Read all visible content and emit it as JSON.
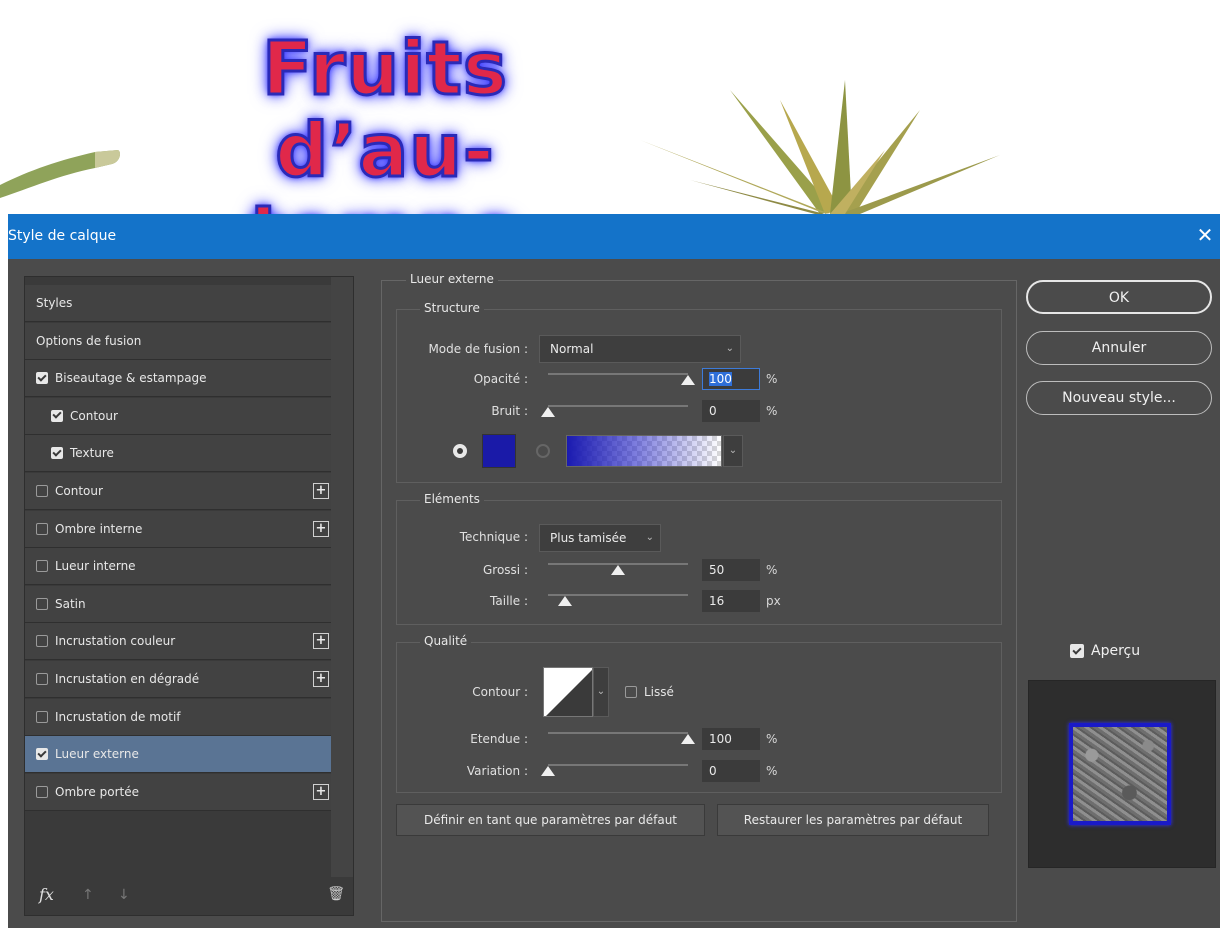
{
  "canvas": {
    "title_line1": "Fruits d’au-",
    "title_line2": "tomne"
  },
  "dialog": {
    "title": "Style de calque",
    "close_label": "✕"
  },
  "styles_list": {
    "items": [
      {
        "label": "Styles",
        "checkbox": false,
        "checked": false,
        "plus": false,
        "sub": false,
        "active": false
      },
      {
        "label": "Options de fusion",
        "checkbox": false,
        "checked": false,
        "plus": false,
        "sub": false,
        "active": false
      },
      {
        "label": "Biseautage & estampage",
        "checkbox": true,
        "checked": true,
        "plus": false,
        "sub": false,
        "active": false
      },
      {
        "label": "Contour",
        "checkbox": true,
        "checked": true,
        "plus": false,
        "sub": true,
        "active": false
      },
      {
        "label": "Texture",
        "checkbox": true,
        "checked": true,
        "plus": false,
        "sub": true,
        "active": false
      },
      {
        "label": "Contour",
        "checkbox": true,
        "checked": false,
        "plus": true,
        "sub": false,
        "active": false
      },
      {
        "label": "Ombre interne",
        "checkbox": true,
        "checked": false,
        "plus": true,
        "sub": false,
        "active": false
      },
      {
        "label": "Lueur interne",
        "checkbox": true,
        "checked": false,
        "plus": false,
        "sub": false,
        "active": false
      },
      {
        "label": "Satin",
        "checkbox": true,
        "checked": false,
        "plus": false,
        "sub": false,
        "active": false
      },
      {
        "label": "Incrustation couleur",
        "checkbox": true,
        "checked": false,
        "plus": true,
        "sub": false,
        "active": false
      },
      {
        "label": "Incrustation en dégradé",
        "checkbox": true,
        "checked": false,
        "plus": true,
        "sub": false,
        "active": false
      },
      {
        "label": "Incrustation de motif",
        "checkbox": true,
        "checked": false,
        "plus": false,
        "sub": false,
        "active": false
      },
      {
        "label": "Lueur externe",
        "checkbox": true,
        "checked": true,
        "plus": false,
        "sub": false,
        "active": true
      },
      {
        "label": "Ombre portée",
        "checkbox": true,
        "checked": false,
        "plus": true,
        "sub": false,
        "active": false
      }
    ],
    "plus_label": "+",
    "fx_label": "fx",
    "up_icon": "↑",
    "down_icon": "↓",
    "trash_icon": "🗑"
  },
  "outer_glow": {
    "section_title": "Lueur externe",
    "structure": {
      "title": "Structure",
      "blend_mode_label": "Mode de fusion :",
      "blend_mode_value": "Normal",
      "opacity_label": "Opacité :",
      "opacity_value": "100",
      "opacity_unit": "%",
      "opacity_level": 1.0,
      "noise_label": "Bruit :",
      "noise_value": "0",
      "noise_unit": "%",
      "noise_level": 0.0,
      "color": "#1a1aa8"
    },
    "elements": {
      "title": "Eléments",
      "technique_label": "Technique :",
      "technique_value": "Plus tamisée",
      "spread_label": "Grossi :",
      "spread_value": "50",
      "spread_unit": "%",
      "spread_level": 0.5,
      "size_label": "Taille :",
      "size_value": "16",
      "size_unit": "px",
      "size_level": 0.12
    },
    "quality": {
      "title": "Qualité",
      "contour_label": "Contour :",
      "smooth_label": "Lissé",
      "range_label": "Etendue :",
      "range_value": "100",
      "range_unit": "%",
      "range_level": 1.0,
      "jitter_label": "Variation :",
      "jitter_value": "0",
      "jitter_unit": "%",
      "jitter_level": 0.0
    },
    "make_default_label": "Définir en tant que paramètres par défaut",
    "reset_default_label": "Restaurer les paramètres par défaut"
  },
  "buttons": {
    "ok": "OK",
    "cancel": "Annuler",
    "new_style": "Nouveau style...",
    "preview_label": "Aperçu"
  },
  "colors": {
    "titlebar": "#1473c9",
    "active_item": "#5a7494",
    "glow_color": "#1a1aa8"
  }
}
